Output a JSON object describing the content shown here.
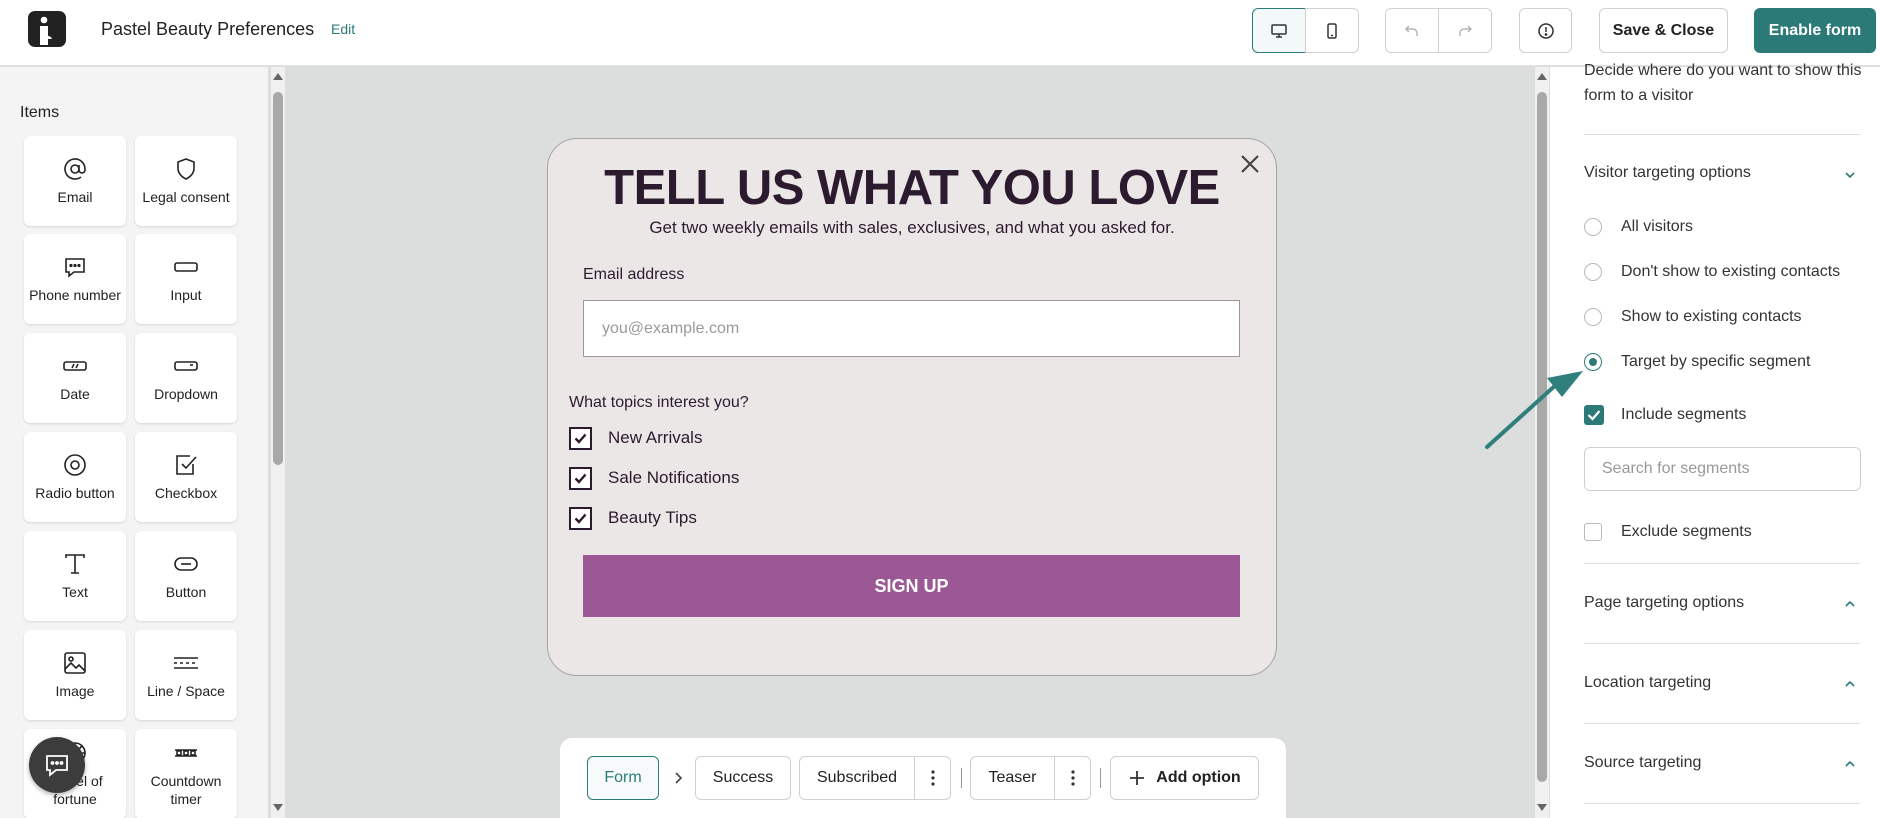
{
  "header": {
    "form_title": "Pastel Beauty Preferences",
    "edit_label": "Edit",
    "save_close_label": "Save & Close",
    "enable_label": "Enable form",
    "icons": [
      "app-logo-icon",
      "desktop-icon",
      "mobile-icon",
      "undo-icon",
      "redo-icon",
      "info-icon"
    ]
  },
  "items_panel": {
    "heading": "Items",
    "items": [
      {
        "label": "Email",
        "icon": "at-sign-icon"
      },
      {
        "label": "Legal consent",
        "icon": "shield-icon"
      },
      {
        "label": "Phone number",
        "icon": "chat-bubble-icon"
      },
      {
        "label": "Input",
        "icon": "input-field-icon"
      },
      {
        "label": "Date",
        "icon": "date-icon"
      },
      {
        "label": "Dropdown",
        "icon": "dropdown-icon"
      },
      {
        "label": "Radio button",
        "icon": "radio-icon"
      },
      {
        "label": "Checkbox",
        "icon": "checkbox-icon"
      },
      {
        "label": "Text",
        "icon": "text-icon"
      },
      {
        "label": "Button",
        "icon": "button-icon"
      },
      {
        "label": "Image",
        "icon": "image-icon"
      },
      {
        "label": "Line / Space",
        "icon": "line-space-icon"
      },
      {
        "label": "Wheel of fortune",
        "icon": "wheel-icon"
      },
      {
        "label": "Countdown timer",
        "icon": "timer-icon"
      }
    ]
  },
  "popup": {
    "headline": "TELL US WHAT YOU LOVE",
    "subheadline": "Get two weekly emails with sales, exclusives, and what you asked for.",
    "email_label": "Email address",
    "email_placeholder": "you@example.com",
    "topics_label": "What topics interest you?",
    "topics": [
      {
        "label": "New Arrivals",
        "checked": true
      },
      {
        "label": "Sale Notifications",
        "checked": true
      },
      {
        "label": "Beauty Tips",
        "checked": true
      }
    ],
    "submit_label": "SIGN UP",
    "colors": {
      "headline": "#2c1a2e",
      "button": "#9c5894",
      "background": "#ece7e7"
    }
  },
  "steps": {
    "form": "Form",
    "success": "Success",
    "subscribed": "Subscribed",
    "teaser": "Teaser",
    "add_option": "Add option"
  },
  "targeting": {
    "description": "Decide where do you want to show this form to a visitor",
    "visitor_section": "Visitor targeting options",
    "options": [
      {
        "label": "All visitors",
        "selected": false
      },
      {
        "label": "Don't show to existing contacts",
        "selected": false
      },
      {
        "label": "Show to existing contacts",
        "selected": false
      },
      {
        "label": "Target by specific segment",
        "selected": true
      }
    ],
    "include_label": "Include segments",
    "include_checked": true,
    "search_placeholder": "Search for segments",
    "exclude_label": "Exclude segments",
    "exclude_checked": false,
    "page_section": "Page targeting options",
    "location_section": "Location targeting",
    "source_section": "Source targeting",
    "accent_color": "#2c7a78"
  }
}
